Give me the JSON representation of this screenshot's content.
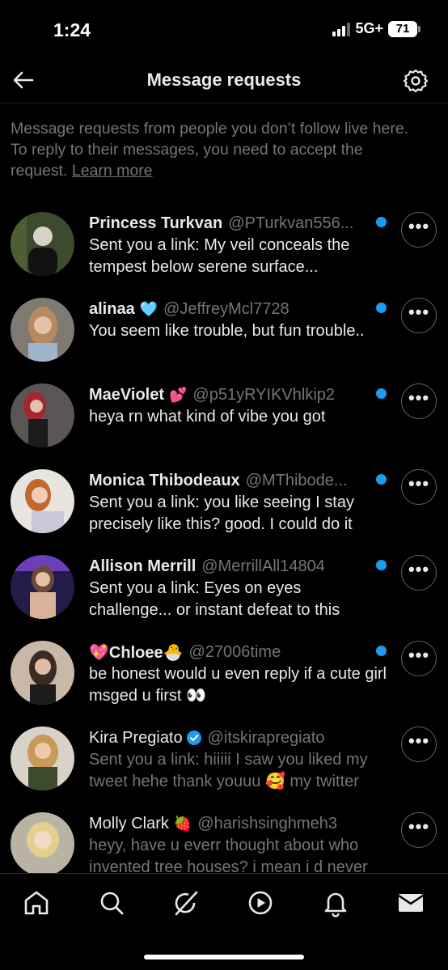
{
  "status_bar": {
    "time": "1:24",
    "network": "5G+",
    "battery": "71"
  },
  "header": {
    "title": "Message requests"
  },
  "info": {
    "text": "Message requests from people you don’t follow live here. To reply to their messages, you need to accept the request.",
    "learn_more": "Learn more"
  },
  "requests": [
    {
      "name": "Princess Turkvan",
      "emoji": "",
      "handle": "@PTurkvan556...",
      "preview": "Sent you a link: My veil conceals the tempest below serene surface...",
      "unread": true,
      "verified": false
    },
    {
      "name": "alinaa",
      "emoji": "🩵",
      "handle": "@JeffreyMcl7728",
      "preview": "You seem like trouble, but fun trouble..",
      "unread": true,
      "verified": false
    },
    {
      "name": "MaeViolet",
      "emoji": "💕",
      "handle": "@p51yRYIKVhlkip2",
      "preview": "heya rn what kind of vibe you got",
      "unread": true,
      "verified": false
    },
    {
      "name": "Monica Thibodeaux",
      "emoji": "",
      "handle": "@MThibode...",
      "preview": "Sent you a link: you like seeing I stay precisely like this? good. I could do it",
      "unread": true,
      "verified": false
    },
    {
      "name": "Allison Merrill",
      "emoji": "",
      "handle": "@MerrillAll14804",
      "preview": "Sent you a link: Eyes on eyes challenge... or instant defeat to this",
      "unread": true,
      "verified": false
    },
    {
      "name": "💖Chloee🐣",
      "emoji": "",
      "handle": "@27006time",
      "preview": "be honest would u even reply if a cute girl msged u first 👀",
      "unread": true,
      "verified": false
    },
    {
      "name": "Kira Pregiato",
      "emoji": "",
      "handle": "@itskirapregiato",
      "preview": "Sent you a link: hiiiii I saw you liked my tweet hehe thank youuu 🥰 my twitter",
      "unread": false,
      "verified": true
    },
    {
      "name": "Molly Clark",
      "emoji": "🍓",
      "handle": "@harishsinghmeh3",
      "preview": "heyy, have u everr thought about who invented tree houses? i mean i d never",
      "unread": false,
      "verified": false
    }
  ],
  "more_glyph": "•••",
  "colors": {
    "accent": "#1d9bf0",
    "muted": "#71767b",
    "background": "#000000"
  },
  "nav": [
    "home-icon",
    "search-icon",
    "grok-icon",
    "video-icon",
    "bell-icon",
    "mail-icon"
  ]
}
